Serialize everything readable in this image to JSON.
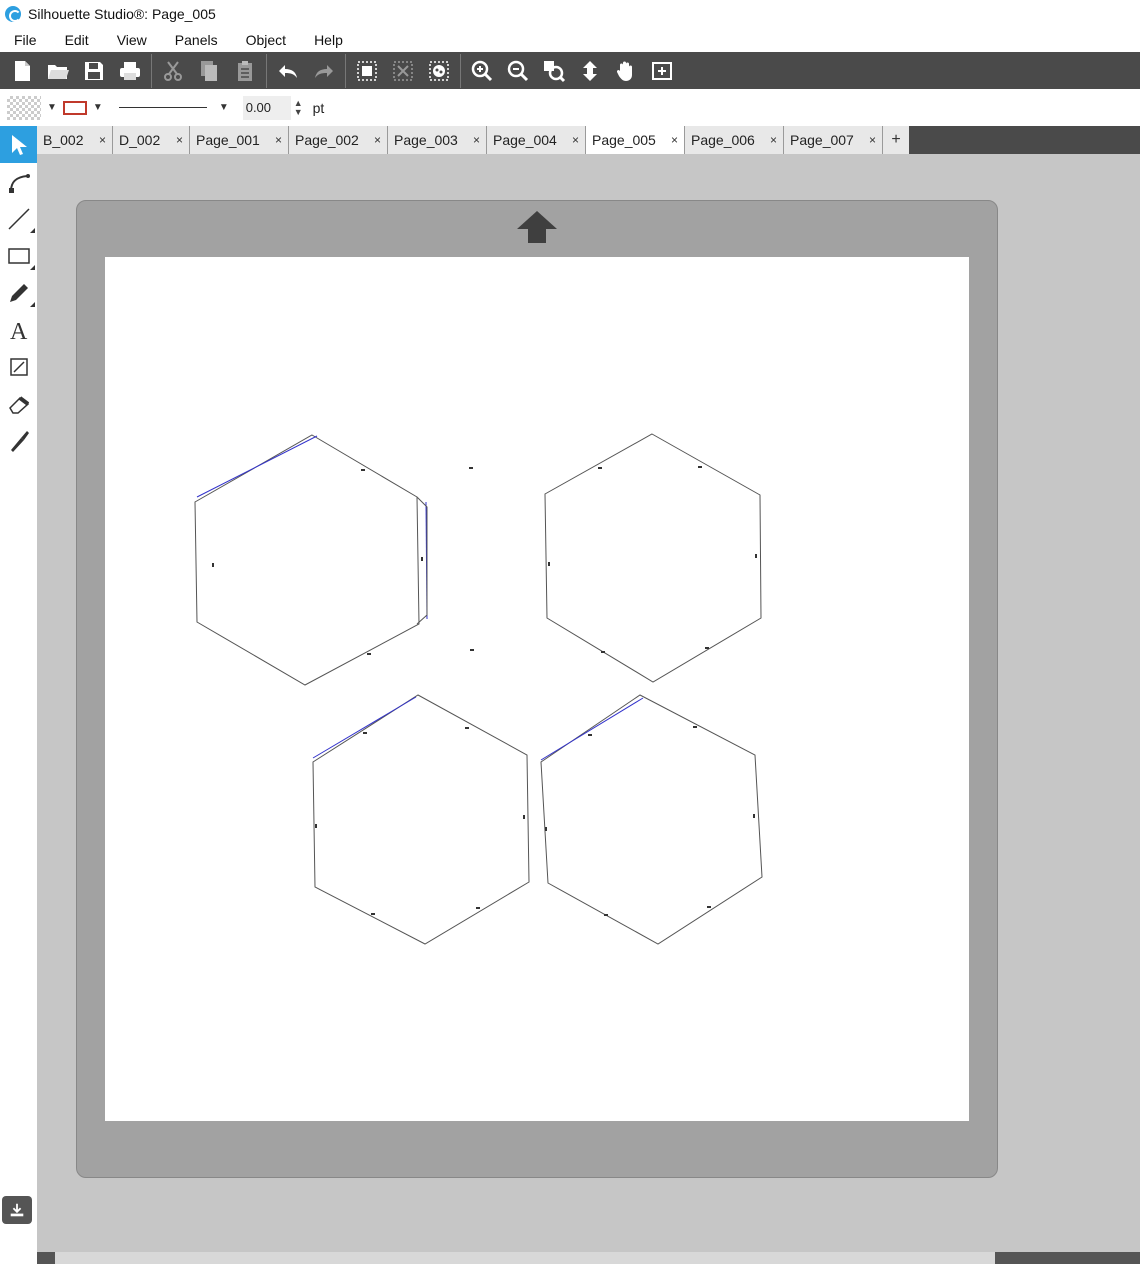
{
  "window": {
    "title": "Silhouette Studio®: Page_005"
  },
  "menu": [
    "File",
    "Edit",
    "View",
    "Panels",
    "Object",
    "Help"
  ],
  "toolbar": {
    "icons": [
      "new-document-icon",
      "open-folder-icon",
      "save-icon",
      "print-icon",
      "cut-icon",
      "copy-icon",
      "paste-icon",
      "undo-icon",
      "redo-icon",
      "group-icon",
      "ungroup-icon",
      "compound-path-icon",
      "zoom-in-icon",
      "zoom-out-icon",
      "zoom-select-icon",
      "fit-to-page-icon",
      "pan-hand-icon",
      "add-page-icon"
    ]
  },
  "properties": {
    "line_width": "0.00",
    "unit": "pt",
    "line_color": "#c0392b"
  },
  "tools": [
    "select-tool",
    "point-edit-tool",
    "line-tool",
    "rectangle-tool",
    "pencil-tool",
    "text-tool",
    "draw-tool",
    "eraser-tool",
    "knife-tool"
  ],
  "tabs": [
    {
      "label": "B_002",
      "active": false
    },
    {
      "label": "D_002",
      "active": false
    },
    {
      "label": "Page_001",
      "active": false
    },
    {
      "label": "Page_002",
      "active": false
    },
    {
      "label": "Page_003",
      "active": false
    },
    {
      "label": "Page_004",
      "active": false
    },
    {
      "label": "Page_005",
      "active": true
    },
    {
      "label": "Page_006",
      "active": false
    },
    {
      "label": "Page_007",
      "active": false
    }
  ],
  "tab_close_glyph": "×",
  "tab_add_glyph": "+",
  "canvas": {
    "shape_count": 4,
    "shape_type": "hexagon",
    "outline_color": "#555555",
    "highlight_color": "#3333cc"
  }
}
